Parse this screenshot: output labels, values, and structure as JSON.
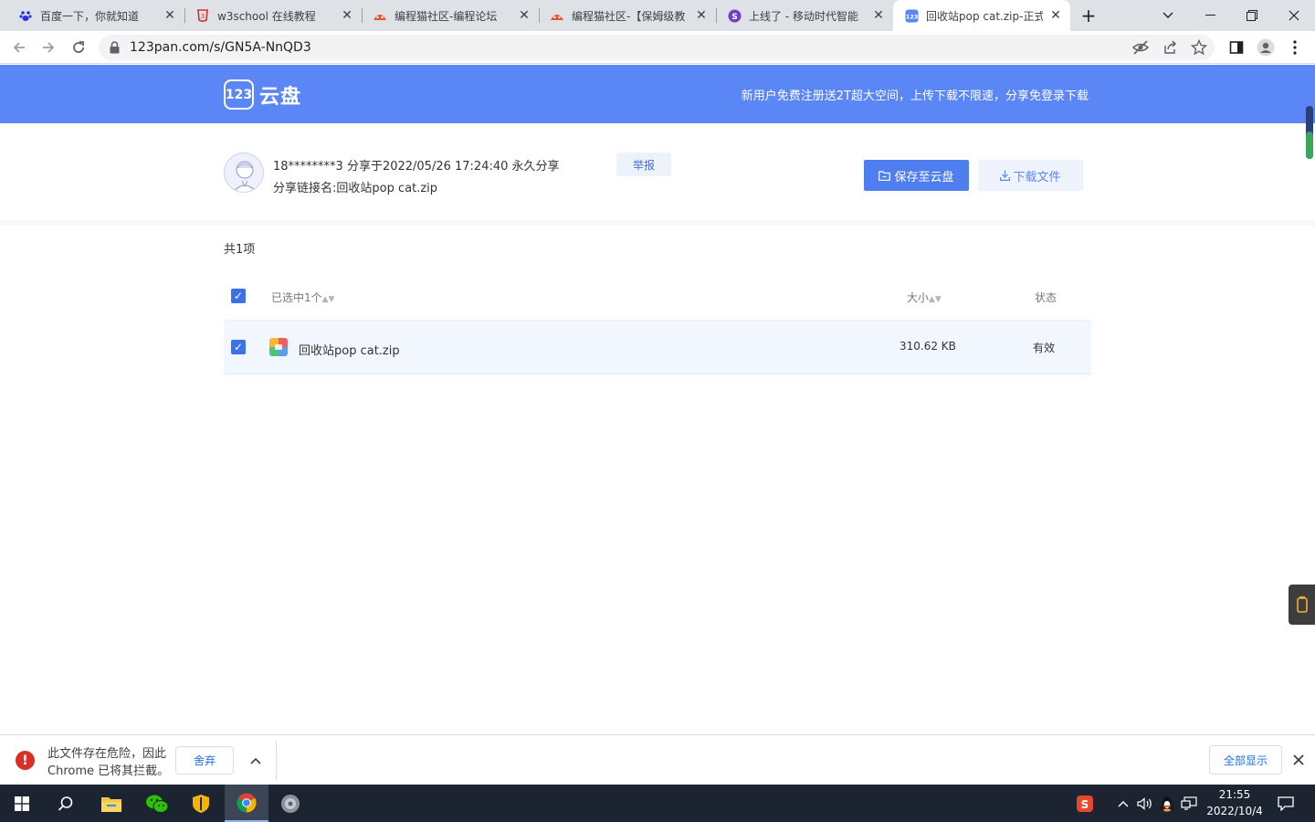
{
  "browser": {
    "tabs": [
      {
        "title": "百度一下，你就知道",
        "icon": "baidu-paw-icon",
        "color": "#2932e1"
      },
      {
        "title": "w3school 在线教程",
        "icon": "w3school-icon",
        "color": "#d0322c"
      },
      {
        "title": "编程猫社区-编程论坛",
        "icon": "codemao-icon",
        "color": "#e5532d"
      },
      {
        "title": "编程猫社区-【保姆级教",
        "icon": "codemao-icon",
        "color": "#e5532d"
      },
      {
        "title": "上线了 - 移动时代智能",
        "icon": "s-circle-icon",
        "color": "#6f42c1"
      },
      {
        "title": "回收站pop cat.zip-正式",
        "icon": "123pan-icon",
        "color": "#5b86f5"
      }
    ],
    "url": "123pan.com/s/GN5A-NnQD3"
  },
  "site": {
    "logo_badge": "123",
    "logo_text": "云盘",
    "promo": "新用户免费注册送2T超大空间，上传下载不限速，分享免登录下载",
    "accent": "#5b86f5"
  },
  "share": {
    "line1": "18********3 分享于2022/05/26 17:24:40 永久分享",
    "line2": "分享链接名:回收站pop cat.zip",
    "report_label": "举报",
    "save_label": "保存至云盘",
    "download_label": "下载文件"
  },
  "list": {
    "count": "共1项",
    "header": {
      "selected": "已选中1个",
      "size": "大小",
      "status": "状态"
    },
    "rows": [
      {
        "name": "回收站pop cat.zip",
        "size": "310.62 KB",
        "status": "有效"
      }
    ]
  },
  "download_bar": {
    "message_line1": "此文件存在危险，因此",
    "message_line2": "Chrome 已将其拦截。",
    "discard_label": "舍弃",
    "show_all_label": "全部显示"
  },
  "taskbar": {
    "time": "21:55",
    "date": "2022/10/4"
  }
}
